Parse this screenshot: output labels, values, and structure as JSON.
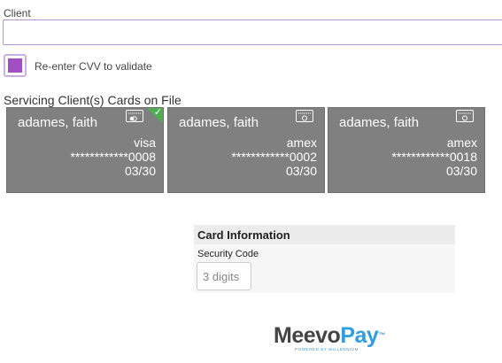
{
  "client": {
    "label": "Client",
    "value": "",
    "placeholder": ""
  },
  "cvv": {
    "label": "Re-enter CVV to validate",
    "checked": true,
    "color": "#a24fc2"
  },
  "cards_section": {
    "title": "Servicing Client(s) Cards on File",
    "cards": [
      {
        "name": "adames, faith",
        "brand": "visa",
        "number": "************0008",
        "exp": "03/30",
        "selected": true
      },
      {
        "name": "adames, faith",
        "brand": "amex",
        "number": "************0002",
        "exp": "03/30",
        "selected": false
      },
      {
        "name": "adames, faith",
        "brand": "amex",
        "number": "************0018",
        "exp": "03/30",
        "selected": false
      }
    ],
    "card_color": "#808080",
    "selected_check_color": "#4caf50"
  },
  "card_information": {
    "header": "Card Information",
    "security_code_label": "Security Code",
    "security_code_placeholder": "3 digits"
  },
  "logo": {
    "meevo": "Meevo",
    "pay": "Pay",
    "tm": "™",
    "subtitle": "POWERED BY MILLENNIUM"
  }
}
